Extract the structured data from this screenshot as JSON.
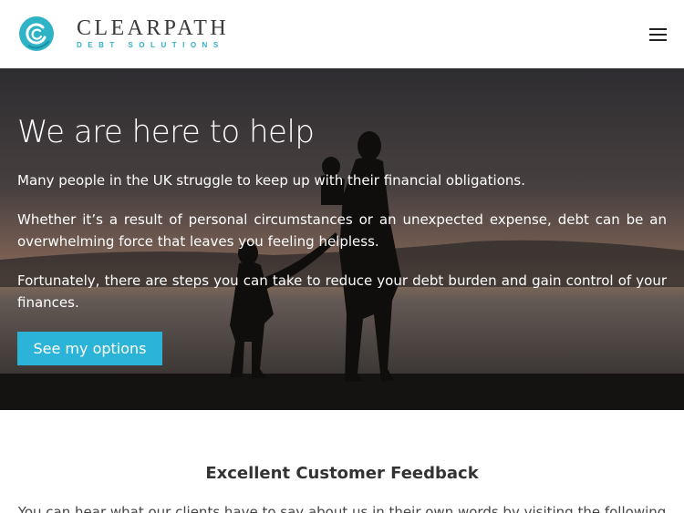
{
  "header": {
    "brand_name": "CLEARPATH",
    "brand_tagline": "DEBT SOLUTIONS",
    "menu_icon": "hamburger-menu-icon",
    "accent_color": "#2fb3c7"
  },
  "hero": {
    "title": "We are here to help",
    "paragraphs": [
      "Many people in the UK struggle to keep up with their financial obligations.",
      "Whether it’s a result of personal circumstances or an unexpected expense, debt can be an overwhelming force that leaves you feeling helpless.",
      "Fortunately, there are steps you can take to reduce your debt burden and gain control of your finances."
    ],
    "cta_label": "See my options",
    "cta_color": "#2bb4d8"
  },
  "feedback": {
    "title": "Excellent Customer Feedback",
    "text": "You can hear what our clients have to say about us in their own words by visiting the following"
  }
}
